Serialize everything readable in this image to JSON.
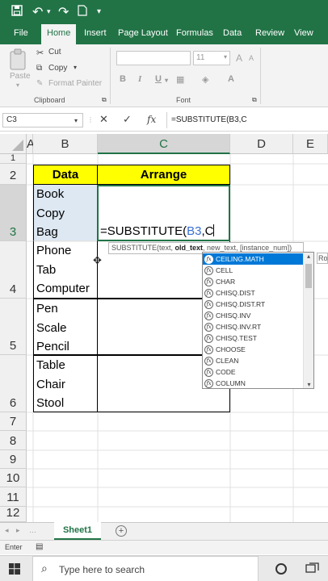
{
  "ribbon_tabs": [
    "File",
    "Home",
    "Insert",
    "Page Layout",
    "Formulas",
    "Data",
    "Review",
    "View"
  ],
  "active_tab": "Home",
  "clipboard": {
    "cut": "Cut",
    "copy": "Copy",
    "format_painter": "Format Painter",
    "paste": "Paste",
    "group": "Clipboard"
  },
  "font": {
    "size": "11",
    "group": "Font",
    "bold": "B",
    "italic": "I",
    "underline": "U"
  },
  "name_box": "C3",
  "formula_bar": "=SUBSTITUTE(B3,C",
  "fx": "fx",
  "columns": [
    "A",
    "B",
    "C",
    "D",
    "E"
  ],
  "rows": [
    "1",
    "2",
    "3",
    "4",
    "5",
    "6",
    "7",
    "8",
    "9",
    "10",
    "11",
    "12"
  ],
  "table": {
    "header_data": "Data",
    "header_arrange": "Arrange",
    "row3": [
      "Book",
      "Copy",
      "Bag"
    ],
    "row4": [
      "Phone",
      "Tab",
      "Computer"
    ],
    "row5": [
      "Pen",
      "Scale",
      "Pencil"
    ],
    "row6": [
      "Table",
      "Chair",
      "Stool"
    ],
    "editing_prefix": "=SUBSTITUTE(",
    "editing_ref": "B3",
    "editing_suffix": ",C"
  },
  "tooltip": {
    "prefix": "SUBSTITUTE(text, ",
    "bold": "old_text",
    "suffix": ", new_text, [instance_num])"
  },
  "partial_next_tip": "Ro",
  "autocomplete": [
    "CEILING.MATH",
    "CELL",
    "CHAR",
    "CHISQ.DIST",
    "CHISQ.DIST.RT",
    "CHISQ.INV",
    "CHISQ.INV.RT",
    "CHISQ.TEST",
    "CHOOSE",
    "CLEAN",
    "CODE",
    "COLUMN"
  ],
  "sheet_tab": "Sheet1",
  "status": "Enter",
  "search_placeholder": "Type here to search",
  "colors": {
    "excel_green": "#217346",
    "header_yellow": "#ffff00",
    "selection_blue": "#0078d7"
  }
}
